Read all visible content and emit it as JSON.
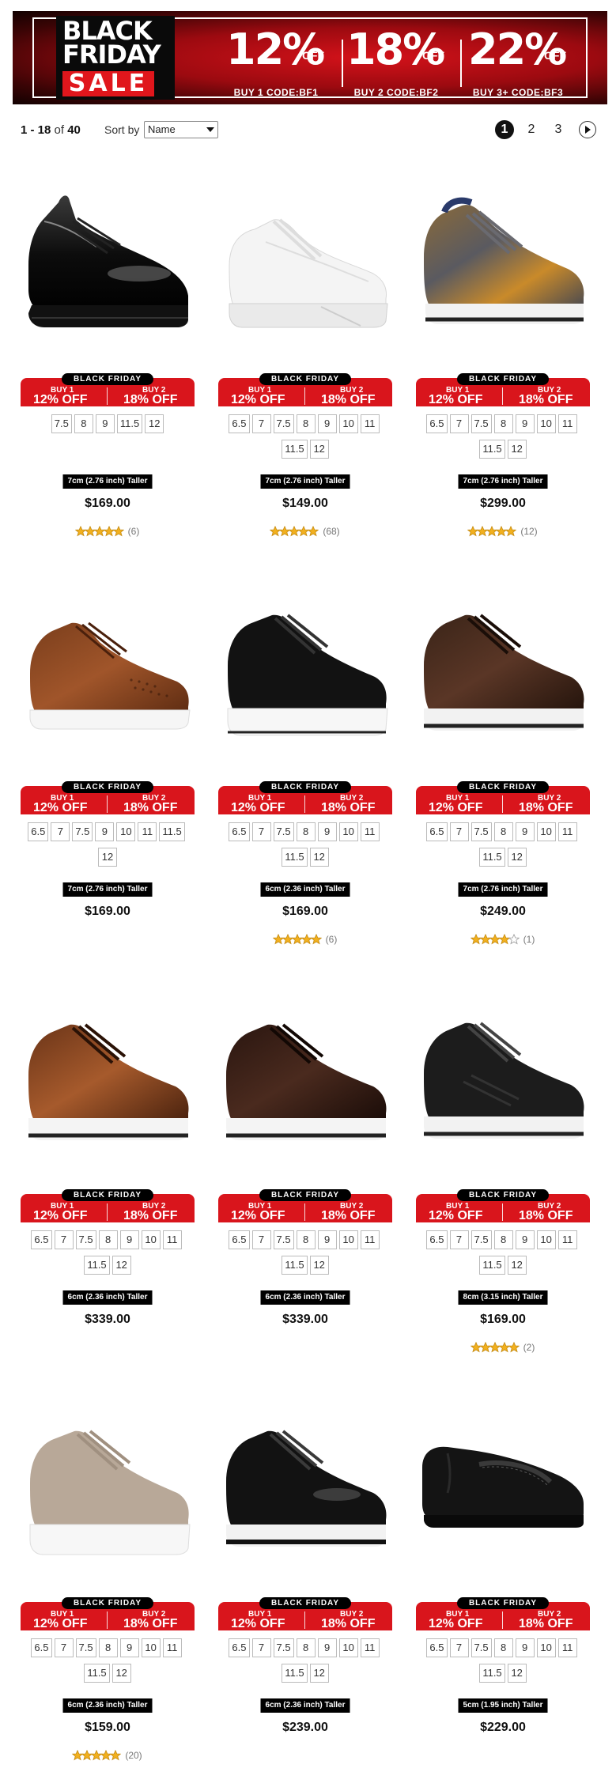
{
  "banner": {
    "line1": "BLACK",
    "line2": "FRIDAY",
    "line3": "SALE",
    "deals": [
      {
        "pct": "12%",
        "off": "OFF",
        "code": "BUY 1  CODE:BF1"
      },
      {
        "pct": "18%",
        "off": "OFF",
        "code": "BUY 2  CODE:BF2"
      },
      {
        "pct": "22%",
        "off": "OFF",
        "code": "BUY 3+  CODE:BF3"
      }
    ]
  },
  "toolbar": {
    "range": "1 - 18",
    "of": "of",
    "total": "40",
    "sort_label": "Sort by",
    "sort_value": "Name",
    "pages": [
      "1",
      "2",
      "3"
    ]
  },
  "promo": {
    "pill": "BLACK FRIDAY",
    "buy1": "BUY 1",
    "off1": "12% OFF",
    "buy2": "BUY 2",
    "off2": "18% OFF"
  },
  "colors": {
    "promo_red": "#d9151c",
    "star_gold": "#f2b01e",
    "banner_red": "#d4121a"
  },
  "products": [
    {
      "sizes": [
        "7.5",
        "8",
        "9",
        "11.5",
        "12"
      ],
      "height": "7cm (2.76 inch) Taller",
      "price": "$169.00",
      "rating": 5,
      "reviews": "(6)",
      "style": "black-derby"
    },
    {
      "sizes": [
        "6.5",
        "7",
        "7.5",
        "8",
        "9",
        "10",
        "11",
        "11.5",
        "12"
      ],
      "height": "7cm (2.76 inch) Taller",
      "price": "$149.00",
      "rating": 5,
      "reviews": "(68)",
      "style": "white-sneaker"
    },
    {
      "sizes": [
        "6.5",
        "7",
        "7.5",
        "8",
        "9",
        "10",
        "11",
        "11.5",
        "12"
      ],
      "height": "7cm (2.76 inch) Taller",
      "price": "$299.00",
      "rating": 5,
      "reviews": "(12)",
      "style": "camo-sneaker"
    },
    {
      "sizes": [
        "6.5",
        "7",
        "7.5",
        "9",
        "10",
        "11",
        "11.5",
        "12"
      ],
      "height": "7cm (2.76 inch) Taller",
      "price": "$169.00",
      "rating": 0,
      "reviews": "",
      "style": "brown-perforated"
    },
    {
      "sizes": [
        "6.5",
        "7",
        "7.5",
        "8",
        "9",
        "10",
        "11",
        "11.5",
        "12"
      ],
      "height": "6cm (2.36 inch) Taller",
      "price": "$169.00",
      "rating": 5,
      "reviews": "(6)",
      "style": "black-suede"
    },
    {
      "sizes": [
        "6.5",
        "7",
        "7.5",
        "8",
        "9",
        "10",
        "11",
        "11.5",
        "12"
      ],
      "height": "7cm (2.76 inch) Taller",
      "price": "$249.00",
      "rating": 4,
      "reviews": "(1)",
      "style": "darkbrown-sneaker"
    },
    {
      "sizes": [
        "6.5",
        "7",
        "7.5",
        "8",
        "9",
        "10",
        "11",
        "11.5",
        "12"
      ],
      "height": "6cm (2.36 inch) Taller",
      "price": "$339.00",
      "rating": 0,
      "reviews": "",
      "style": "tan-sneaker"
    },
    {
      "sizes": [
        "6.5",
        "7",
        "7.5",
        "8",
        "9",
        "10",
        "11",
        "11.5",
        "12"
      ],
      "height": "6cm (2.36 inch) Taller",
      "price": "$339.00",
      "rating": 0,
      "reviews": "",
      "style": "espresso-sneaker"
    },
    {
      "sizes": [
        "6.5",
        "7",
        "7.5",
        "8",
        "9",
        "10",
        "11",
        "11.5",
        "12"
      ],
      "height": "8cm (3.15 inch) Taller",
      "price": "$169.00",
      "rating": 5,
      "reviews": "(2)",
      "style": "black-runner"
    },
    {
      "sizes": [
        "6.5",
        "7",
        "7.5",
        "8",
        "9",
        "10",
        "11",
        "11.5",
        "12"
      ],
      "height": "6cm (2.36 inch) Taller",
      "price": "$159.00",
      "rating": 5,
      "reviews": "(20)",
      "style": "taupe-suede"
    },
    {
      "sizes": [
        "6.5",
        "7",
        "7.5",
        "8",
        "9",
        "10",
        "11",
        "11.5",
        "12"
      ],
      "height": "6cm (2.36 inch) Taller",
      "price": "$239.00",
      "rating": 0,
      "reviews": "",
      "style": "black-leather-runner"
    },
    {
      "sizes": [
        "6.5",
        "7",
        "7.5",
        "8",
        "9",
        "10",
        "11",
        "11.5",
        "12"
      ],
      "height": "5cm (1.95 inch) Taller",
      "price": "$229.00",
      "rating": 0,
      "reviews": "",
      "style": "black-loafer-mule"
    }
  ]
}
